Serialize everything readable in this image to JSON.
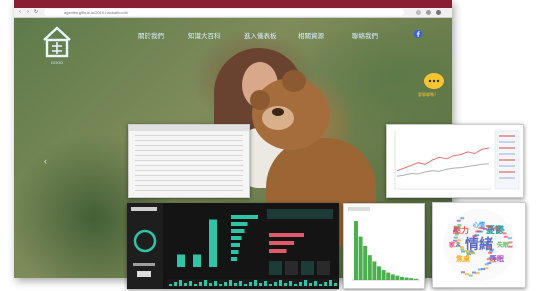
{
  "browser": {
    "url": "agenttw.github.io/2019-hackathon/#/"
  },
  "site": {
    "logo_text": "GOOD",
    "nav_items": [
      "關於我們",
      "知識大百科",
      "進入儀表板",
      "相關資源"
    ],
    "nav_extra": "聯絡我們",
    "chat_label": "要聊聊嗎？"
  },
  "colors": {
    "tab_bar": "#8a1f33",
    "dashboard_accent": "#2ec4a8",
    "dashboard_alert": "#e05a6a",
    "line_series_1": "#e57373",
    "line_series_2": "#b0b0b0",
    "histogram": "#4caf50"
  },
  "dashboard": {
    "bar_values": [
      0.25,
      0.25,
      0.95
    ],
    "hbar_values": [
      0.9,
      0.55,
      0.45,
      0.35,
      0.3,
      0.25,
      0.2
    ],
    "alert_bars": [
      0.7,
      0.5,
      0.35
    ]
  },
  "line_chart": {
    "series_1": [
      0.3,
      0.35,
      0.4,
      0.45,
      0.42,
      0.5,
      0.55,
      0.52,
      0.58,
      0.6,
      0.65,
      0.62,
      0.7,
      0.72
    ],
    "series_2": [
      0.2,
      0.22,
      0.25,
      0.24,
      0.28,
      0.3,
      0.29,
      0.33,
      0.35,
      0.36,
      0.38,
      0.4,
      0.42,
      0.43
    ]
  },
  "histogram": {
    "values": [
      0.95,
      0.7,
      0.55,
      0.4,
      0.3,
      0.22,
      0.16,
      0.12,
      0.09,
      0.07,
      0.05,
      0.04,
      0.03,
      0.02
    ]
  },
  "word_cloud": {
    "words": [
      "情緒",
      "憂鬱",
      "壓力",
      "焦慮",
      "睡眠",
      "心情",
      "失眠",
      "家人"
    ]
  }
}
